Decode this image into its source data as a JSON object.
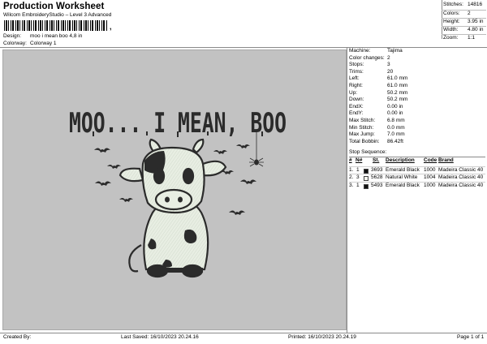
{
  "header": {
    "title": "Production Worksheet",
    "subtitle": "Wilcom EmbroideryStudio – Level 3 Advanced",
    "barcode_suffix": ","
  },
  "meta": {
    "design_label": "Design:",
    "design_value": "moo i mean boo 4,8 in",
    "colorway_label": "Colorway:",
    "colorway_value": "Colorway 1"
  },
  "stats": [
    {
      "label": "Stitches:",
      "value": "14816"
    },
    {
      "label": "Colors:",
      "value": "2"
    },
    {
      "label": "Height:",
      "value": "3.95 in"
    },
    {
      "label": "Width:",
      "value": "4.80 in"
    },
    {
      "label": "Zoom:",
      "value": "1:1"
    }
  ],
  "artwork": {
    "caption": "MOO... I MEAN, BOO",
    "fill_white": "#e6ede1",
    "ink_black": "#2b2b2b"
  },
  "machine_info": [
    {
      "label": "Machine:",
      "value": "Tajima"
    },
    {
      "label": "Color changes:",
      "value": "2"
    },
    {
      "label": "Stops:",
      "value": "3"
    },
    {
      "label": "Trims:",
      "value": "20"
    },
    {
      "label": "Left:",
      "value": "61.0 mm"
    },
    {
      "label": "Right:",
      "value": "61.0 mm"
    },
    {
      "label": "Up:",
      "value": "50.2 mm"
    },
    {
      "label": "Down:",
      "value": "50.2 mm"
    },
    {
      "label": "EndX:",
      "value": "0.00 in"
    },
    {
      "label": "EndY:",
      "value": "0.00 in"
    },
    {
      "label": "Max Stitch:",
      "value": "6.8 mm"
    },
    {
      "label": "Min Stitch:",
      "value": "0.0 mm"
    },
    {
      "label": "Max Jump:",
      "value": "7.0 mm"
    },
    {
      "label": "Total Bobbin:",
      "value": "86.42ft"
    }
  ],
  "stop_sequence": {
    "title": "Stop Sequence:",
    "headers": [
      "#",
      "N#",
      "St.",
      "Description",
      "Code",
      "Brand"
    ],
    "rows": [
      {
        "num": "1.",
        "n": "1",
        "swatch": "#111111",
        "st": "3693",
        "desc": "Emerald Black",
        "code": "1000",
        "brand": "Madeira Classic 40"
      },
      {
        "num": "2.",
        "n": "3",
        "swatch": "#f4f4ee",
        "st": "5628",
        "desc": "Natural White",
        "code": "1004",
        "brand": "Madeira Classic 40"
      },
      {
        "num": "3.",
        "n": "1",
        "swatch": "#111111",
        "st": "5493",
        "desc": "Emerald Black",
        "code": "1000",
        "brand": "Madeira Classic 40"
      }
    ]
  },
  "footer": {
    "created_by": "Created By:",
    "last_saved": "Last Saved: 16/10/2023 20.24.16",
    "printed": "Printed: 16/10/2023 20.24.19",
    "page": "Page 1 of 1"
  }
}
